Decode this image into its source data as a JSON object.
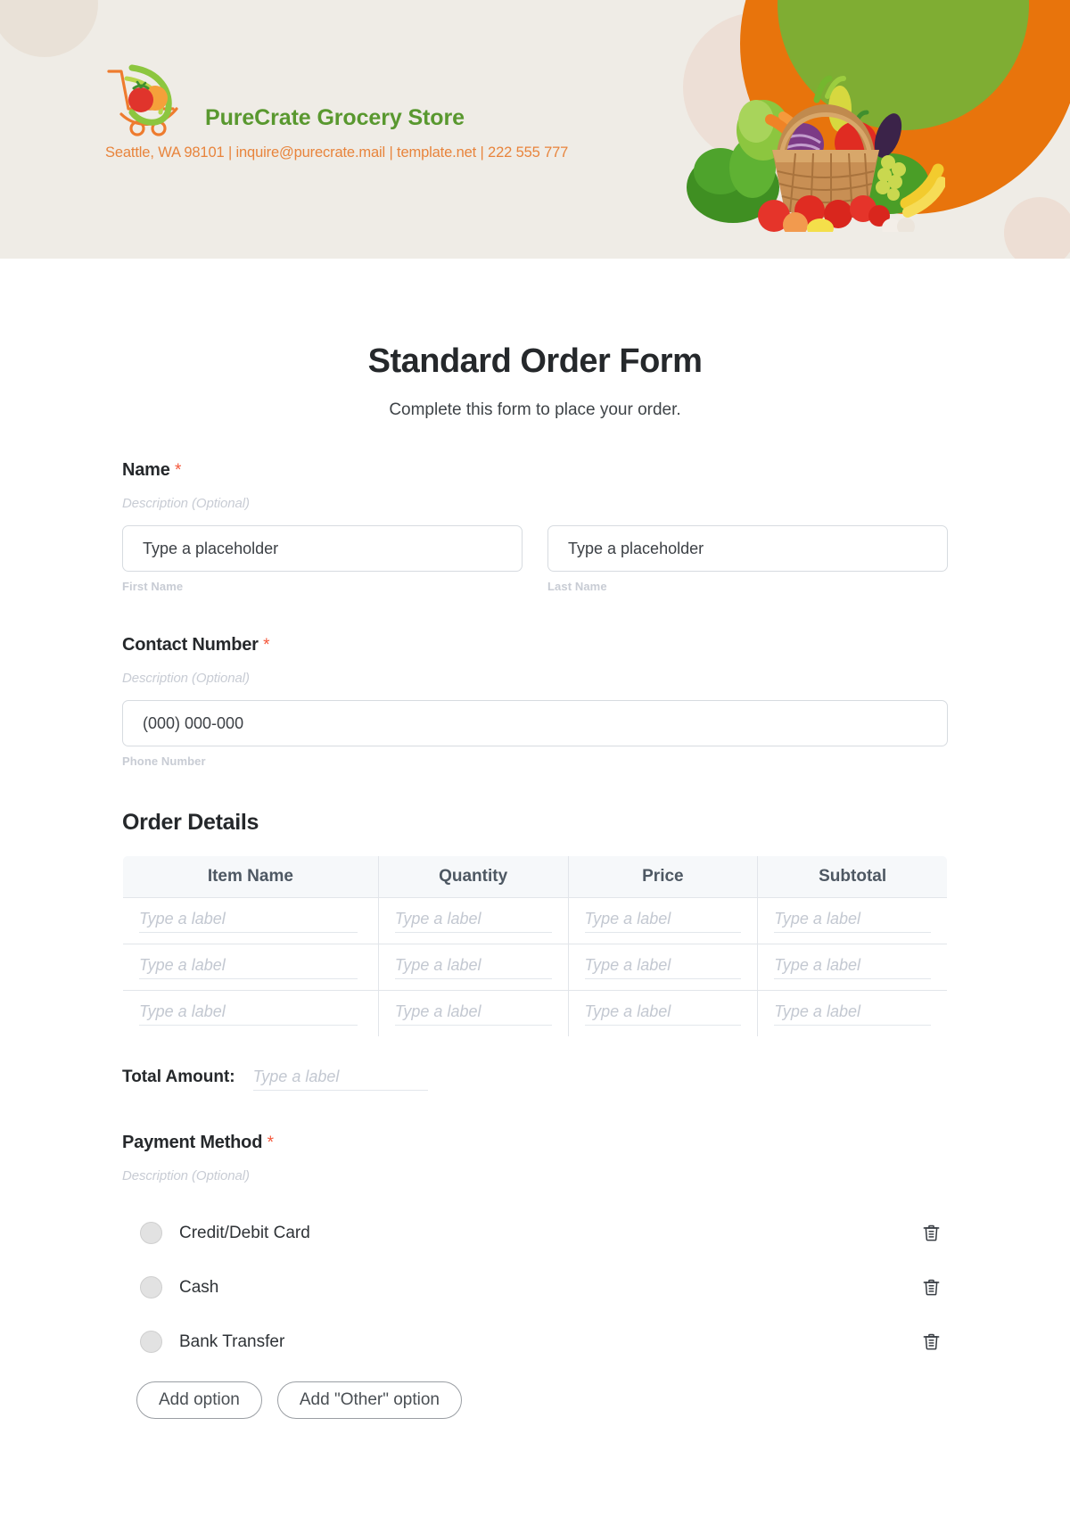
{
  "header": {
    "brand_name": "PureCrate Grocery Store",
    "contact_line": "Seattle, WA 98101 | inquire@purecrate.mail | template.net | 222 555 777",
    "colors": {
      "background": "#efece6",
      "brand_green": "#59982f",
      "contact_orange": "#e8843c",
      "circle_orange": "#e8740c",
      "circle_green": "#7fad33",
      "circle_beige": "#ecddd2"
    }
  },
  "form": {
    "title": "Standard Order Form",
    "subtitle": "Complete this form to place your order.",
    "required_marker": "*",
    "description_placeholder": "Description (Optional)"
  },
  "name_field": {
    "label": "Name",
    "required": true,
    "description": "Description (Optional)",
    "first": {
      "placeholder": "Type a placeholder",
      "sub_label": "First Name"
    },
    "last": {
      "placeholder": "Type a placeholder",
      "sub_label": "Last Name"
    }
  },
  "contact_field": {
    "label": "Contact Number",
    "required": true,
    "description": "Description (Optional)",
    "placeholder": "(000) 000-000",
    "sub_label": "Phone Number"
  },
  "order_details": {
    "section_title": "Order Details",
    "columns": [
      "Item Name",
      "Quantity",
      "Price",
      "Subtotal"
    ],
    "cell_placeholder": "Type a label",
    "rows": [
      [
        "Type a label",
        "Type a label",
        "Type a label",
        "Type a label"
      ],
      [
        "Type a label",
        "Type a label",
        "Type a label",
        "Type a label"
      ],
      [
        "Type a label",
        "Type a label",
        "Type a label",
        "Type a label"
      ]
    ],
    "total_label": "Total Amount:",
    "total_placeholder": "Type a label"
  },
  "payment_method": {
    "label": "Payment Method",
    "required": true,
    "description": "Description (Optional)",
    "options": [
      {
        "label": "Credit/Debit Card",
        "selected": false,
        "delete_icon": "trash-icon"
      },
      {
        "label": "Cash",
        "selected": false,
        "delete_icon": "trash-icon"
      },
      {
        "label": "Bank Transfer",
        "selected": false,
        "delete_icon": "trash-icon"
      }
    ],
    "add_option_label": "Add option",
    "add_other_option_label": "Add \"Other\" option"
  }
}
